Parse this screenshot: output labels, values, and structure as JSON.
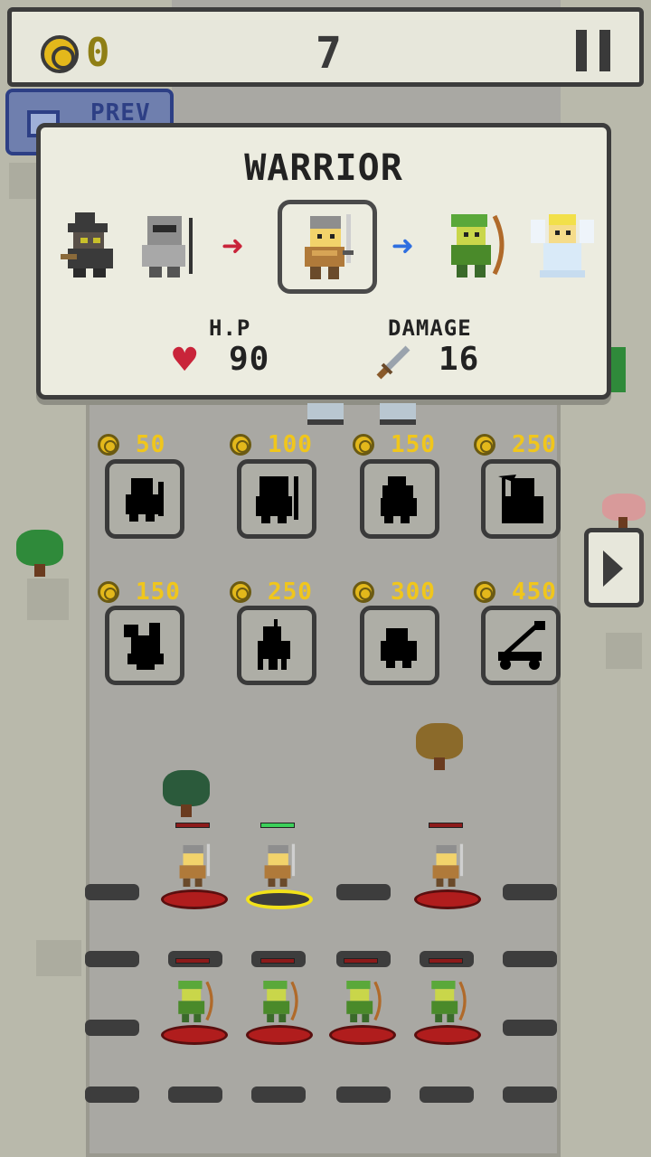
{
  "top_bar": {
    "coins": "0",
    "wave": "7",
    "pause_icon": "pause-icon"
  },
  "prev_button": {
    "label": "PREV",
    "icon": "video-icon"
  },
  "unit_panel": {
    "title": "WARRIOR",
    "evolution_chain": [
      "dark-mage",
      "knight",
      "warrior",
      "elf-archer",
      "angel"
    ],
    "selected": "warrior",
    "hp_label": "H.P",
    "hp_value": "90",
    "damage_label": "DAMAGE",
    "damage_value": "16",
    "colors": {
      "prev_arrow": "#c9243a",
      "next_arrow": "#2f6fe0"
    }
  },
  "shop": {
    "row1": [
      {
        "price": "50",
        "unit": "shield-soldier-silhouette"
      },
      {
        "price": "100",
        "unit": "armored-soldier-silhouette"
      },
      {
        "price": "150",
        "unit": "hooded-unit-silhouette"
      },
      {
        "price": "250",
        "unit": "reaper-silhouette"
      }
    ],
    "row2": [
      {
        "price": "150",
        "unit": "dragon-silhouette"
      },
      {
        "price": "250",
        "unit": "spearman-silhouette"
      },
      {
        "price": "300",
        "unit": "beast-silhouette"
      },
      {
        "price": "450",
        "unit": "catapult-silhouette"
      }
    ]
  },
  "battlefield": {
    "row1": [
      "warrior",
      "warrior-selected",
      "empty",
      "warrior"
    ],
    "row3": [
      "elf-archer",
      "elf-archer",
      "elf-archer",
      "elf-archer"
    ]
  }
}
